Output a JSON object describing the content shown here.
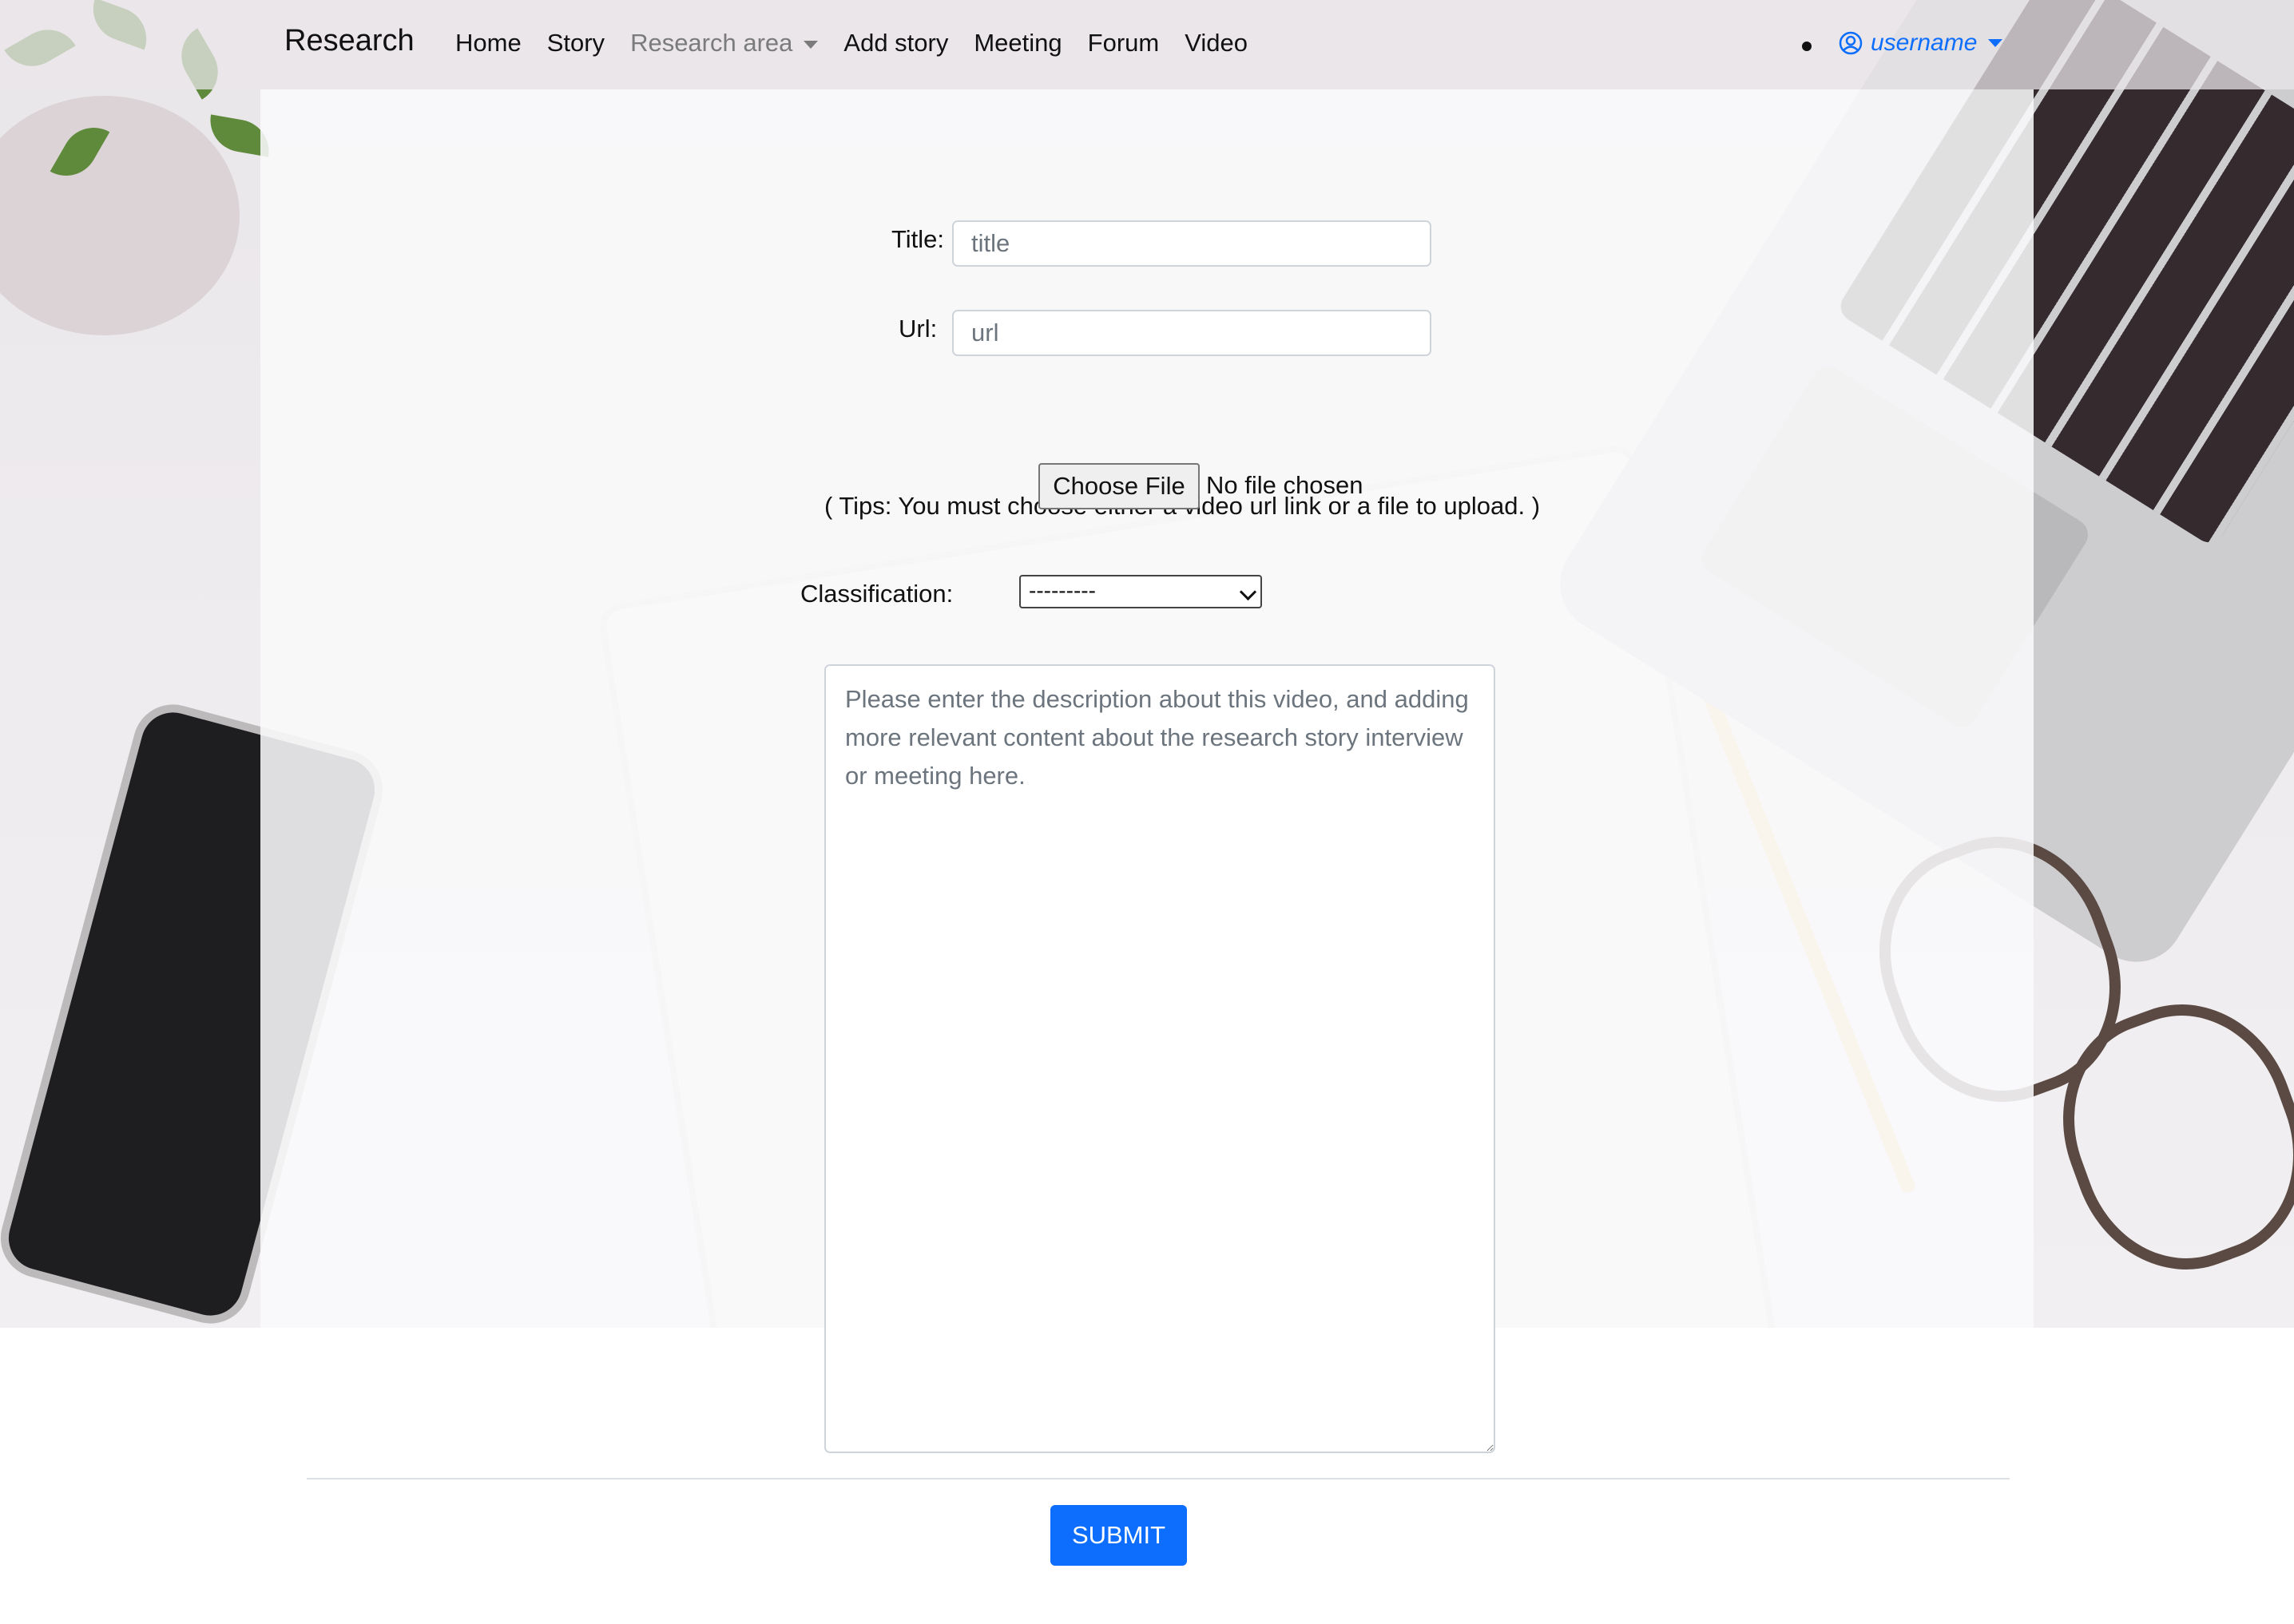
{
  "navbar": {
    "brand": "Research",
    "links": [
      {
        "label": "Home"
      },
      {
        "label": "Story"
      },
      {
        "label": "Research area"
      },
      {
        "label": "Add story"
      },
      {
        "label": "Meeting"
      },
      {
        "label": "Forum"
      },
      {
        "label": "Video"
      }
    ],
    "user": {
      "label": "username",
      "icon": "user-circle-icon"
    }
  },
  "form": {
    "title": {
      "label": "Title:",
      "placeholder": "title",
      "value": ""
    },
    "url": {
      "label": "Url:",
      "placeholder": "url",
      "value": ""
    },
    "tips": "( Tips: You must choose either a video url link or a file to upload. )",
    "file": {
      "button_label": "Choose File",
      "status": "No file chosen"
    },
    "classification": {
      "label": "Classification:",
      "selected": "---------"
    },
    "description": {
      "placeholder": "Please enter the description about this video, and adding more relevant content about the research story interview or meeting here.",
      "value": ""
    },
    "submit_label": "SUBMIT"
  },
  "colors": {
    "accent": "#0d6efd",
    "nav_muted": "#7b7b7b"
  }
}
